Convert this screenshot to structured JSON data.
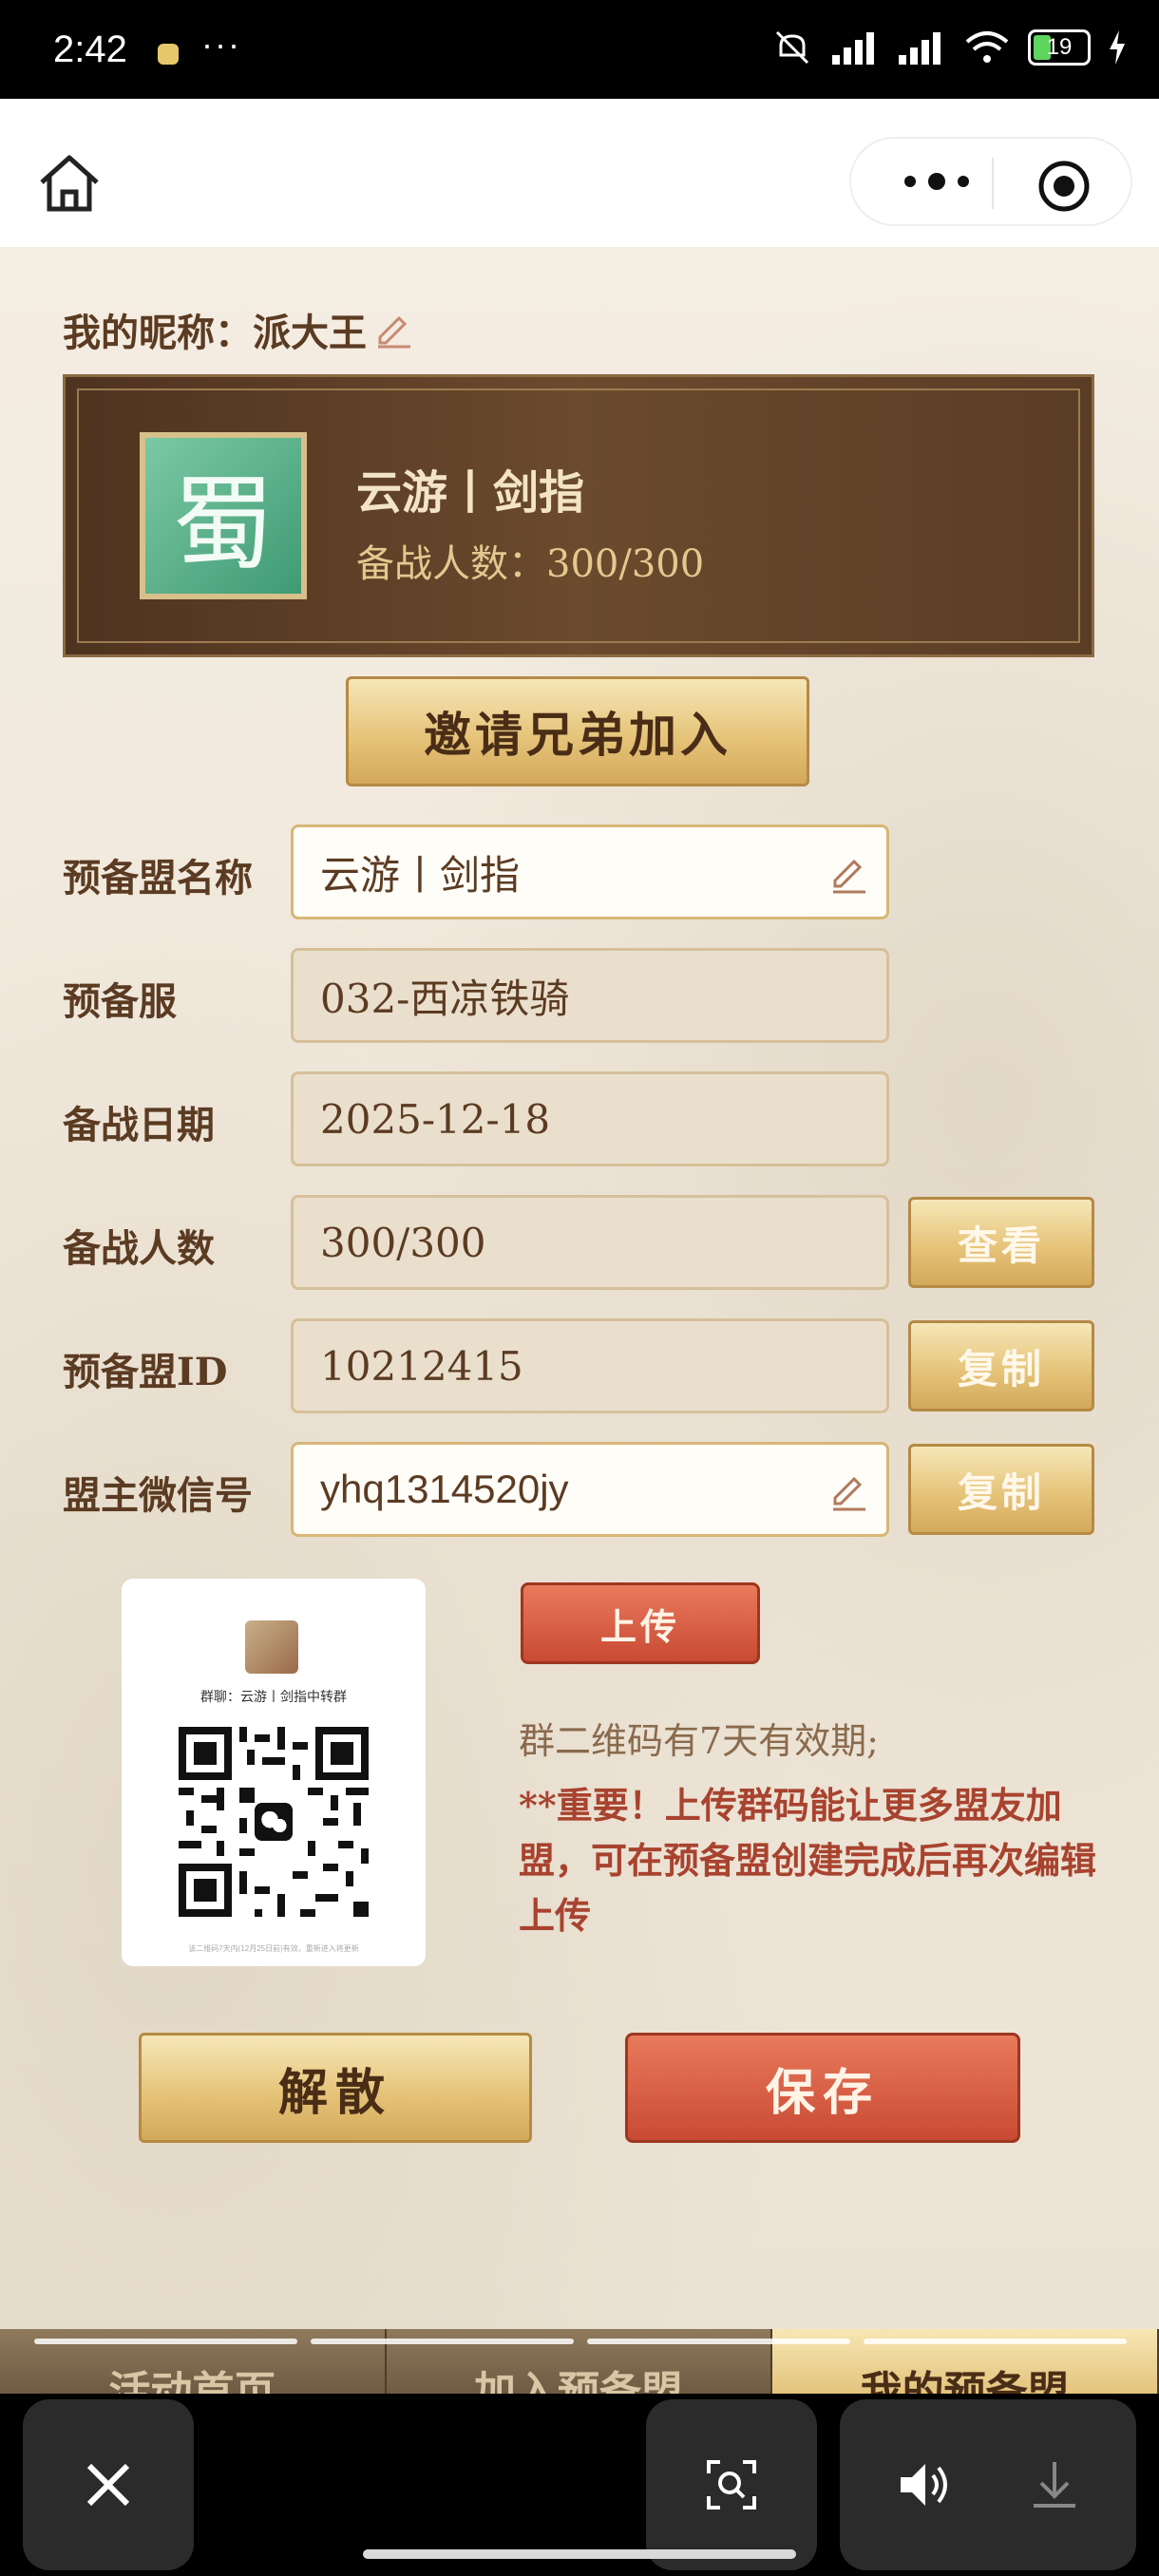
{
  "status_bar": {
    "time": "2:42",
    "more": "···",
    "battery": "19"
  },
  "profile": {
    "nickname": "我的昵称：派大王"
  },
  "alliance_banner": {
    "emblem": "蜀",
    "name": "云游丨剑指",
    "count": "备战人数：300/300"
  },
  "invite_button": "邀请兄弟加入",
  "form": {
    "name_label": "预备盟名称",
    "name_value": "云游丨剑指",
    "server_label": "预备服",
    "server_value": "032-西凉铁骑",
    "date_label": "备战日期",
    "date_value": "2025-12-18",
    "count_label": "备战人数",
    "count_value": "300/300",
    "view_button": "查看",
    "id_label": "预备盟ID",
    "id_value": "10212415",
    "copy_id_button": "复制",
    "wechat_label": "盟主微信号",
    "wechat_value": "yhq1314520jy",
    "copy_wechat_button": "复制"
  },
  "qr": {
    "group_name": "群聊：云游丨剑指中转群",
    "note": "该二维码7天内(12月25日前)有效，重新进入将更新"
  },
  "upload_button": "上传",
  "hint_validity": "群二维码有7天有效期;",
  "hint_important": "**重要！上传群码能让更多盟友加盟，可在预备盟创建完成后再次编辑上传",
  "actions": {
    "dissolve": "解散",
    "save": "保存"
  },
  "tabs": [
    "活动首页",
    "加入预备盟",
    "我的预备盟"
  ],
  "colors": {
    "gold": "#e6c47a",
    "red": "#c94a34",
    "brown": "#5b3b22",
    "emblem_green": "#5bb58a"
  }
}
